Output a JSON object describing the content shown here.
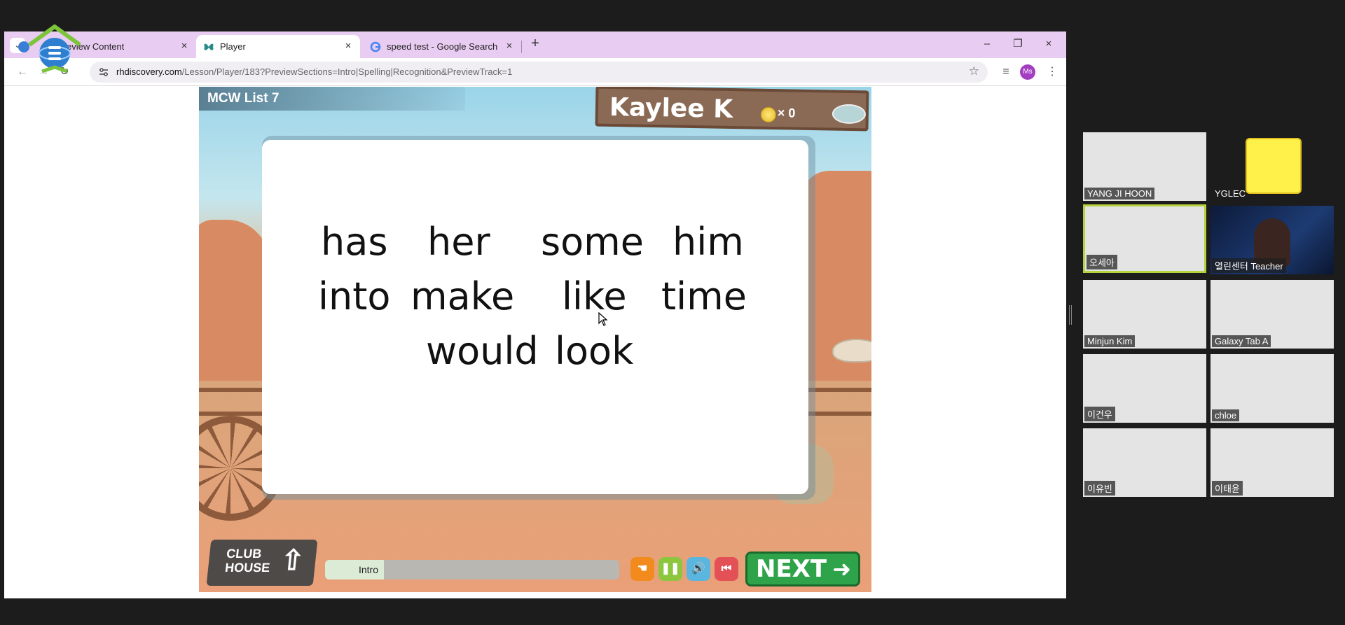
{
  "browser": {
    "tabs": [
      {
        "title": "Preview Content",
        "close": "×"
      },
      {
        "title": "Player",
        "close": "×"
      },
      {
        "title": "speed test - Google Search",
        "close": "×"
      }
    ],
    "new_tab": "+",
    "window": {
      "minimize": "–",
      "restore": "❐",
      "close": "×"
    },
    "url_host": "rhdiscovery.com",
    "url_path": "/Lesson/Player/183?PreviewSections=Intro|Spelling|Recognition&PreviewTrack=1",
    "profile": "Ms"
  },
  "game": {
    "list_title": "MCW List 7",
    "player_name": "Kaylee K",
    "coin_count": "× 0",
    "words": [
      "has",
      "her",
      "some",
      "him",
      "into",
      "make",
      "like",
      "time",
      "would",
      "look"
    ],
    "clubhouse_label_1": "CLUB",
    "clubhouse_label_2": "HOUSE",
    "progress": {
      "label": "Intro",
      "fraction": 0.2
    },
    "next_label": "NEXT"
  },
  "participants": [
    {
      "name": "YANG JI HOON"
    },
    {
      "name": "YGLEC"
    },
    {
      "name": "오세아"
    },
    {
      "name": "열린센터 Teacher"
    },
    {
      "name": "Minjun Kim"
    },
    {
      "name": "Galaxy Tab A"
    },
    {
      "name": "이건우"
    },
    {
      "name": "chloe"
    },
    {
      "name": "이유빈"
    },
    {
      "name": "이태윤"
    }
  ],
  "colors": {
    "tabstrip": "#e9ccf2",
    "next": "#2ea34a",
    "active_speaker": "#b5d33d"
  }
}
